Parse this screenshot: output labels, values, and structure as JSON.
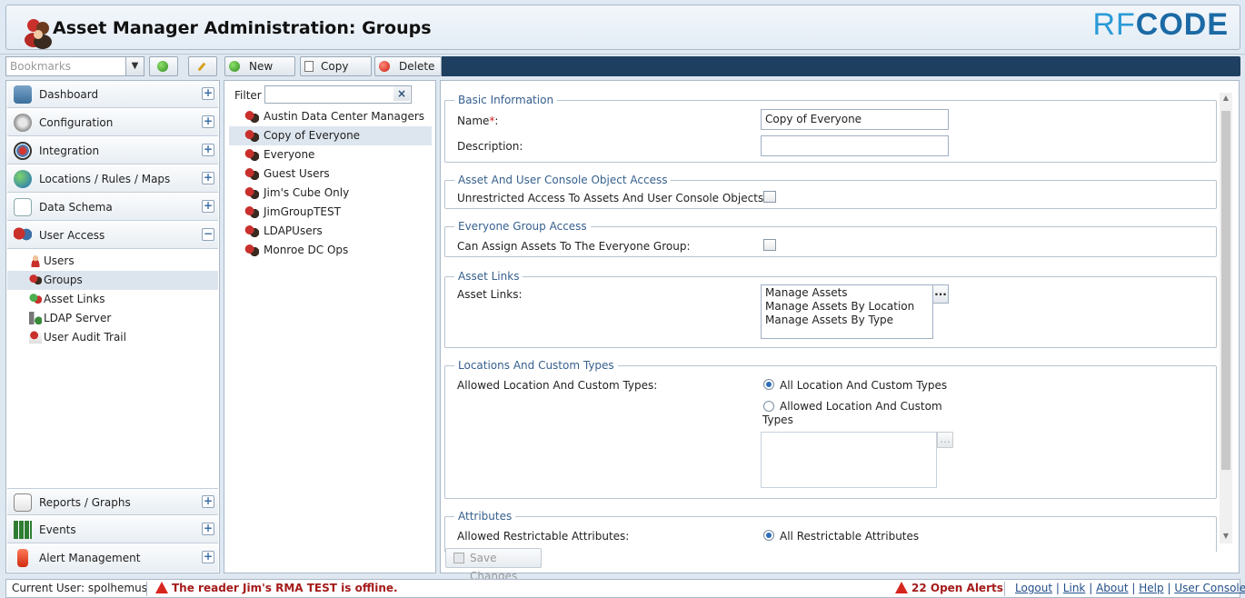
{
  "header": {
    "title": "Asset Manager Administration: Groups",
    "brand_a": "RF",
    "brand_b": "CODE"
  },
  "toolbar": {
    "bookmarks_placeholder": "Bookmarks",
    "new_label": "New",
    "copy_label": "Copy",
    "delete_label": "Delete"
  },
  "sidebar": {
    "sections": [
      {
        "label": "Dashboard",
        "icon": "dashboard-icon",
        "toggle": "+"
      },
      {
        "label": "Configuration",
        "icon": "gear-icon",
        "toggle": "+"
      },
      {
        "label": "Integration",
        "icon": "integration-icon",
        "toggle": "+"
      },
      {
        "label": "Locations / Rules / Maps",
        "icon": "globe-icon",
        "toggle": "+"
      },
      {
        "label": "Data Schema",
        "icon": "schema-icon",
        "toggle": "+"
      },
      {
        "label": "User Access",
        "icon": "users-icon",
        "toggle": "−"
      }
    ],
    "subitems": [
      {
        "label": "Users",
        "icon": "user-icon"
      },
      {
        "label": "Groups",
        "icon": "group-icon",
        "selected": true
      },
      {
        "label": "Asset Links",
        "icon": "asset-links-icon"
      },
      {
        "label": "LDAP Server",
        "icon": "ldap-server-icon"
      },
      {
        "label": "User Audit Trail",
        "icon": "audit-trail-icon"
      }
    ],
    "bottom_sections": [
      {
        "label": "Reports / Graphs",
        "icon": "reports-icon",
        "toggle": "+"
      },
      {
        "label": "Events",
        "icon": "events-icon",
        "toggle": "+"
      },
      {
        "label": "Alert Management",
        "icon": "alert-icon",
        "toggle": "+"
      }
    ]
  },
  "groups_list": {
    "filter_label": "Filter",
    "filter_clear": "×",
    "items": [
      "Austin Data Center Managers",
      "Copy of Everyone",
      "Everyone",
      "Guest Users",
      "Jim's Cube Only",
      "JimGroupTEST",
      "LDAPUsers",
      "Monroe DC Ops"
    ],
    "selected_index": 1
  },
  "form": {
    "basic": {
      "legend": "Basic Information",
      "name_label": "Name",
      "name_required": "*",
      "name_colon": ":",
      "name_value": "Copy of Everyone",
      "description_label": "Description:",
      "description_value": ""
    },
    "console_access": {
      "legend": "Asset And User Console Object Access",
      "label": "Unrestricted Access To Assets And User Console Objects:",
      "checked": false
    },
    "everyone_access": {
      "legend": "Everyone Group Access",
      "label": "Can Assign Assets To The Everyone Group:",
      "checked": false
    },
    "asset_links": {
      "legend": "Asset Links",
      "label": "Asset Links:",
      "items": [
        "Manage Assets",
        "Manage Assets By Location",
        "Manage Assets By Type"
      ],
      "ellipsis": "..."
    },
    "location_types": {
      "legend": "Locations And Custom Types",
      "label": "Allowed Location And Custom Types:",
      "option_all": "All Location And Custom Types",
      "option_allowed_1": "Allowed Location And Custom",
      "option_allowed_2": "Types",
      "selected": "all",
      "ellipsis": "..."
    },
    "attributes": {
      "legend": "Attributes",
      "label": "Allowed Restrictable Attributes:",
      "option_all": "All Restrictable Attributes"
    },
    "save_label": "Save Changes"
  },
  "status_bar": {
    "current_user": "Current User: spolhemus",
    "warning": "The reader Jim's RMA TEST is offline.",
    "alerts": "22 Open Alerts",
    "links": [
      "Logout",
      "Link",
      "About",
      "Help",
      "User Console"
    ],
    "link_separator": "|"
  },
  "colors": {
    "accent": "#36608e",
    "header_bg": "#dfe9f3",
    "toolbar_dark": "#1f3f60",
    "alert_red": "#a51b1b"
  }
}
